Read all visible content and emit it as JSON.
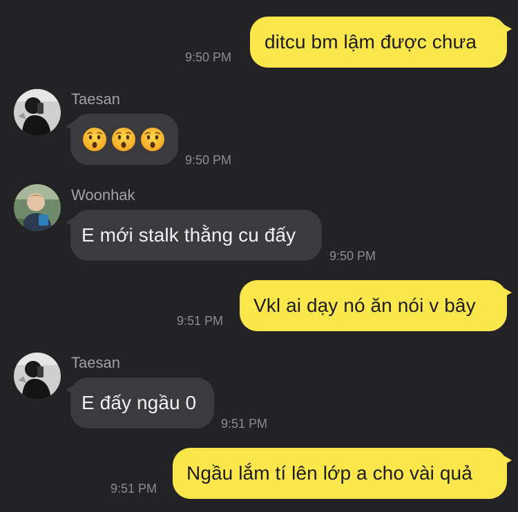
{
  "messages": [
    {
      "sender": "",
      "text": "ditcu bm lậm được chưa",
      "time": "9:50 PM",
      "direction": "outgoing"
    },
    {
      "sender": "Taesan",
      "text": "",
      "emojis": [
        "hushed-face",
        "hushed-face",
        "hushed-face"
      ],
      "time": "9:50 PM",
      "direction": "incoming"
    },
    {
      "sender": "Woonhak",
      "text": "E mới stalk thằng cu đấy",
      "time": "9:50 PM",
      "direction": "incoming"
    },
    {
      "sender": "",
      "text": "Vkl ai dạy nó ăn nói v bây",
      "time": "9:51 PM",
      "direction": "outgoing"
    },
    {
      "sender": "Taesan",
      "text": "E đấy ngầu 0",
      "time": "9:51 PM",
      "direction": "incoming"
    },
    {
      "sender": "",
      "text": "Ngầu lắm tí lên lớp a cho vài quả",
      "time": "9:51 PM",
      "direction": "outgoing"
    }
  ],
  "colors": {
    "background": "#232325",
    "outgoing_bubble": "#fbe64b",
    "incoming_bubble": "#3b3b3d",
    "timestamp": "#8d8d90",
    "sender_name": "#a2a2a5"
  }
}
